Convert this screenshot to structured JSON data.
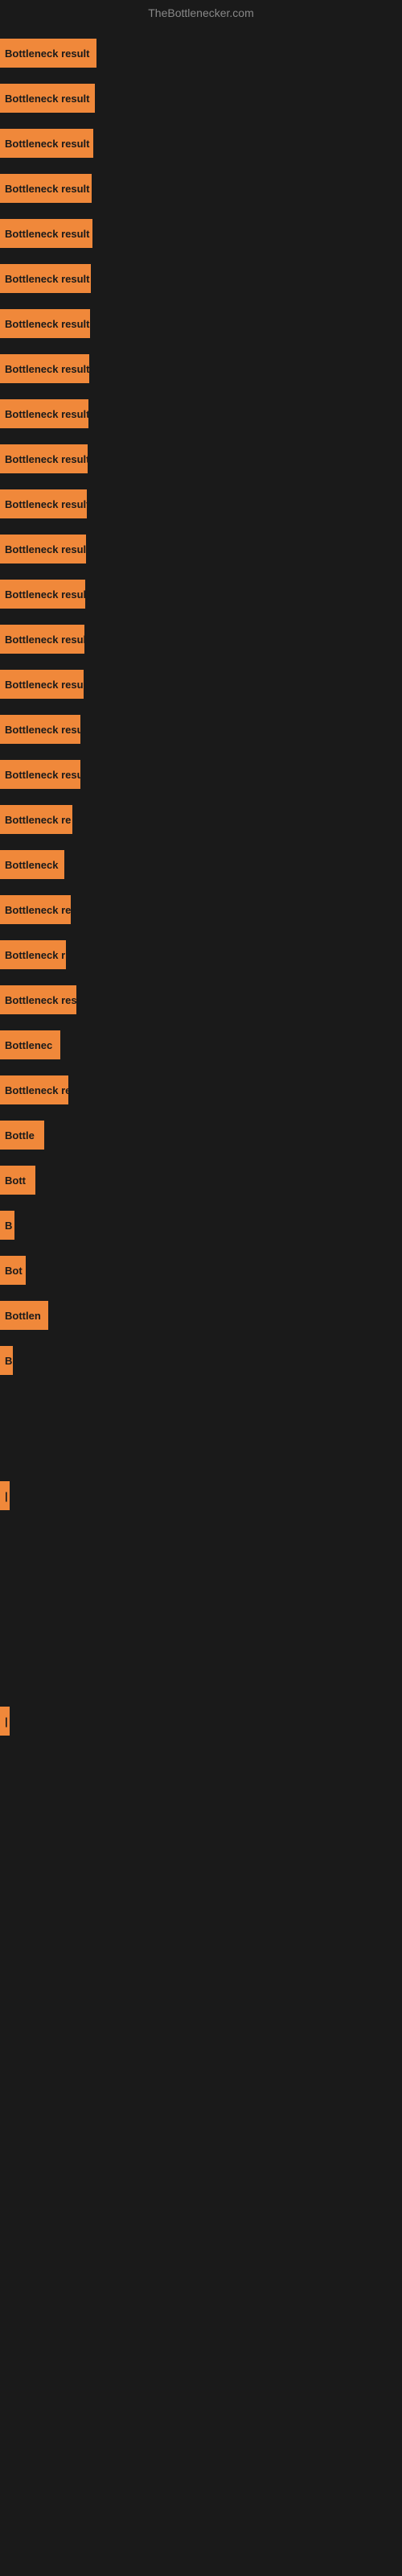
{
  "site": {
    "title": "TheBottlenecker.com"
  },
  "bars": [
    {
      "label": "Bottleneck result",
      "width": 120
    },
    {
      "label": "Bottleneck result",
      "width": 118
    },
    {
      "label": "Bottleneck result",
      "width": 116
    },
    {
      "label": "Bottleneck result",
      "width": 114
    },
    {
      "label": "Bottleneck result",
      "width": 115
    },
    {
      "label": "Bottleneck result",
      "width": 113
    },
    {
      "label": "Bottleneck result",
      "width": 112
    },
    {
      "label": "Bottleneck result",
      "width": 111
    },
    {
      "label": "Bottleneck result",
      "width": 110
    },
    {
      "label": "Bottleneck result",
      "width": 109
    },
    {
      "label": "Bottleneck result",
      "width": 108
    },
    {
      "label": "Bottleneck result",
      "width": 107
    },
    {
      "label": "Bottleneck result",
      "width": 106
    },
    {
      "label": "Bottleneck result",
      "width": 105
    },
    {
      "label": "Bottleneck result",
      "width": 104
    },
    {
      "label": "Bottleneck resu",
      "width": 100
    },
    {
      "label": "Bottleneck result",
      "width": 100
    },
    {
      "label": "Bottleneck re",
      "width": 90
    },
    {
      "label": "Bottleneck",
      "width": 80
    },
    {
      "label": "Bottleneck re",
      "width": 88
    },
    {
      "label": "Bottleneck r",
      "width": 82
    },
    {
      "label": "Bottleneck resu",
      "width": 95
    },
    {
      "label": "Bottlenec",
      "width": 75
    },
    {
      "label": "Bottleneck re",
      "width": 85
    },
    {
      "label": "Bottle",
      "width": 55
    },
    {
      "label": "Bott",
      "width": 44
    },
    {
      "label": "B",
      "width": 18
    },
    {
      "label": "Bot",
      "width": 32
    },
    {
      "label": "Bottlen",
      "width": 60
    },
    {
      "label": "B",
      "width": 16
    },
    {
      "label": "",
      "width": 0
    },
    {
      "label": "",
      "width": 0
    },
    {
      "label": "|",
      "width": 10
    },
    {
      "label": "",
      "width": 0
    },
    {
      "label": "",
      "width": 0
    },
    {
      "label": "",
      "width": 0
    },
    {
      "label": "",
      "width": 0
    },
    {
      "label": "|",
      "width": 10
    }
  ]
}
